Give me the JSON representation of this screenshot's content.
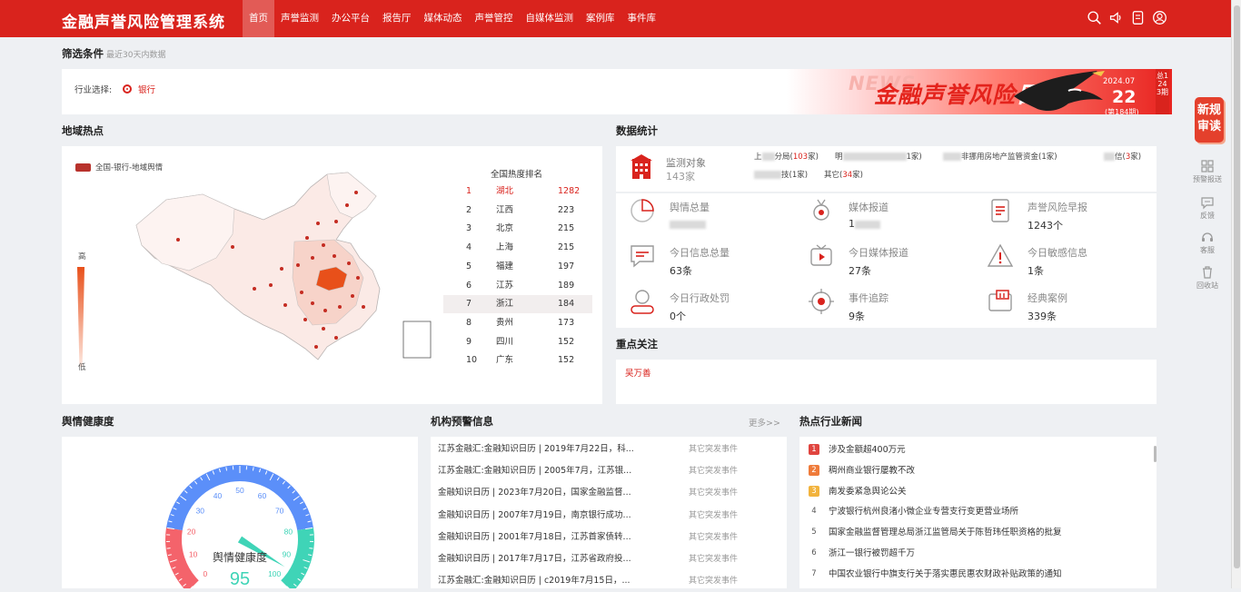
{
  "app": {
    "title": "金融声誉风险管理系统"
  },
  "nav": [
    {
      "label": "首页",
      "active": true
    },
    {
      "label": "声誉监测"
    },
    {
      "label": "办公平台"
    },
    {
      "label": "报告厅"
    },
    {
      "label": "媒体动态"
    },
    {
      "label": "声誉管控"
    },
    {
      "label": "自媒体监测"
    },
    {
      "label": "案例库"
    },
    {
      "label": "事件库"
    }
  ],
  "top_icons": [
    "search-icon",
    "volume-icon",
    "message-icon",
    "user-icon"
  ],
  "filter": {
    "title": "筛选条件",
    "subtitle": "最近30天内数据",
    "industry_label": "行业选择:",
    "industry_value": "银行"
  },
  "banner": {
    "news": "NEWS",
    "title_a": "金融声誉风险",
    "title_b": "日报",
    "month": "2024.07",
    "day": "22",
    "issue": "(第184期)",
    "side": "总1243期"
  },
  "region": {
    "title": "地域热点",
    "legend": "全国-银行-地域舆情",
    "scale_high": "高",
    "scale_low": "低",
    "rank_title": "全国热度排名",
    "ranking": [
      {
        "no": "1",
        "name": "湖北",
        "value": "1282"
      },
      {
        "no": "2",
        "name": "江西",
        "value": "223"
      },
      {
        "no": "3",
        "name": "北京",
        "value": "215"
      },
      {
        "no": "4",
        "name": "上海",
        "value": "215"
      },
      {
        "no": "5",
        "name": "福建",
        "value": "197"
      },
      {
        "no": "6",
        "name": "江苏",
        "value": "189"
      },
      {
        "no": "7",
        "name": "浙江",
        "value": "184"
      },
      {
        "no": "8",
        "name": "贵州",
        "value": "173"
      },
      {
        "no": "9",
        "name": "四川",
        "value": "152"
      },
      {
        "no": "10",
        "name": "广东",
        "value": "152"
      }
    ]
  },
  "stats": {
    "title": "数据统计",
    "monitor_label": "监测对象",
    "monitor_count": "143家",
    "orgs": [
      {
        "pre": "上",
        "post": "分局(",
        "count": "103",
        "tail": "家)"
      },
      {
        "pre": "明",
        "post": "",
        "count": "",
        "tail": "1家)"
      },
      {
        "pre": "",
        "post": "非挪用房地产监管资金(1家)",
        "count": "",
        "tail": ""
      },
      {
        "pre": "",
        "post": "信(",
        "count": "3",
        "tail": "家)"
      },
      {
        "pre": "",
        "post": "技(1家)",
        "count": "",
        "tail": ""
      },
      {
        "pre": "其它(",
        "post": "",
        "count": "34",
        "tail": "家)"
      }
    ],
    "items": [
      {
        "label": "舆情总量",
        "value": "",
        "icon": "pie-chart-icon"
      },
      {
        "label": "媒体报道",
        "value": "1",
        "icon": "medal-icon"
      },
      {
        "label": "声誉风险早报",
        "value": "1243个",
        "icon": "report-icon"
      },
      {
        "label": "今日信息总量",
        "value": "63条",
        "icon": "message-icon"
      },
      {
        "label": "今日媒体报道",
        "value": "27条",
        "icon": "tv-icon"
      },
      {
        "label": "今日敏感信息",
        "value": "1条",
        "icon": "warning-icon"
      },
      {
        "label": "今日行政处罚",
        "value": "0个",
        "icon": "user-penalty-icon"
      },
      {
        "label": "事件追踪",
        "value": "9条",
        "icon": "target-icon"
      },
      {
        "label": "经典案例",
        "value": "339条",
        "icon": "case-icon"
      }
    ]
  },
  "focus": {
    "title": "重点关注",
    "tag": "吴万善"
  },
  "health": {
    "title": "舆情健康度",
    "gauge_label": "舆情健康度",
    "score": "95",
    "score_value": 95,
    "ticks": [
      "0",
      "10",
      "20",
      "30",
      "40",
      "50",
      "60",
      "70",
      "80",
      "90",
      "100"
    ]
  },
  "warnings": {
    "title": "机构预警信息",
    "more": "更多>>",
    "items": [
      {
        "text": "江苏金融汇:金融知识日历 | 2019年7月22日，科...",
        "category": "其它突发事件"
      },
      {
        "text": "江苏金融汇:金融知识日历 | 2005年7月，江苏银...",
        "category": "其它突发事件"
      },
      {
        "text": "金融知识日历 | 2023年7月20日，国家金融监督...",
        "category": "其它突发事件"
      },
      {
        "text": "金融知识日历 | 2007年7月19日，南京银行成功...",
        "category": "其它突发事件"
      },
      {
        "text": "金融知识日历 | 2001年7月18日，江苏首家债转...",
        "category": "其它突发事件"
      },
      {
        "text": "金融知识日历 | 2017年7月17日，江苏省政府投...",
        "category": "其它突发事件"
      },
      {
        "text": "江苏金融汇:金融知识日历 | c2019年7月15日，...",
        "category": "其它突发事件"
      }
    ]
  },
  "hot_news": {
    "title": "热点行业新闻",
    "items": [
      {
        "no": "1",
        "text": "涉及金额超400万元"
      },
      {
        "no": "2",
        "text": "稠州商业银行屡教不改"
      },
      {
        "no": "3",
        "text": "南发委紧急舆论公关"
      },
      {
        "no": "4",
        "text": "宁波银行杭州良渚小微企业专营支行变更营业场所"
      },
      {
        "no": "5",
        "text": "国家金融监督管理总局浙江监管局关于陈哲玮任职资格的批复"
      },
      {
        "no": "6",
        "text": "浙江一银行被罚超千万"
      },
      {
        "no": "7",
        "text": "中国农业银行中旗支行关于落实惠民惠农财政补贴政策的通知"
      }
    ]
  },
  "side_tools": {
    "badge": "新规审读",
    "items": [
      {
        "label": "预警报送",
        "icon": "qrcode-icon"
      },
      {
        "label": "反馈",
        "icon": "feedback-icon"
      },
      {
        "label": "客服",
        "icon": "headset-icon"
      },
      {
        "label": "回收站",
        "icon": "trash-icon"
      }
    ]
  },
  "colors": {
    "brand": "#d9231d",
    "gauge_blue": "#5b8ff9",
    "gauge_teal": "#3fd4b7",
    "gauge_red": "#f4636b"
  }
}
